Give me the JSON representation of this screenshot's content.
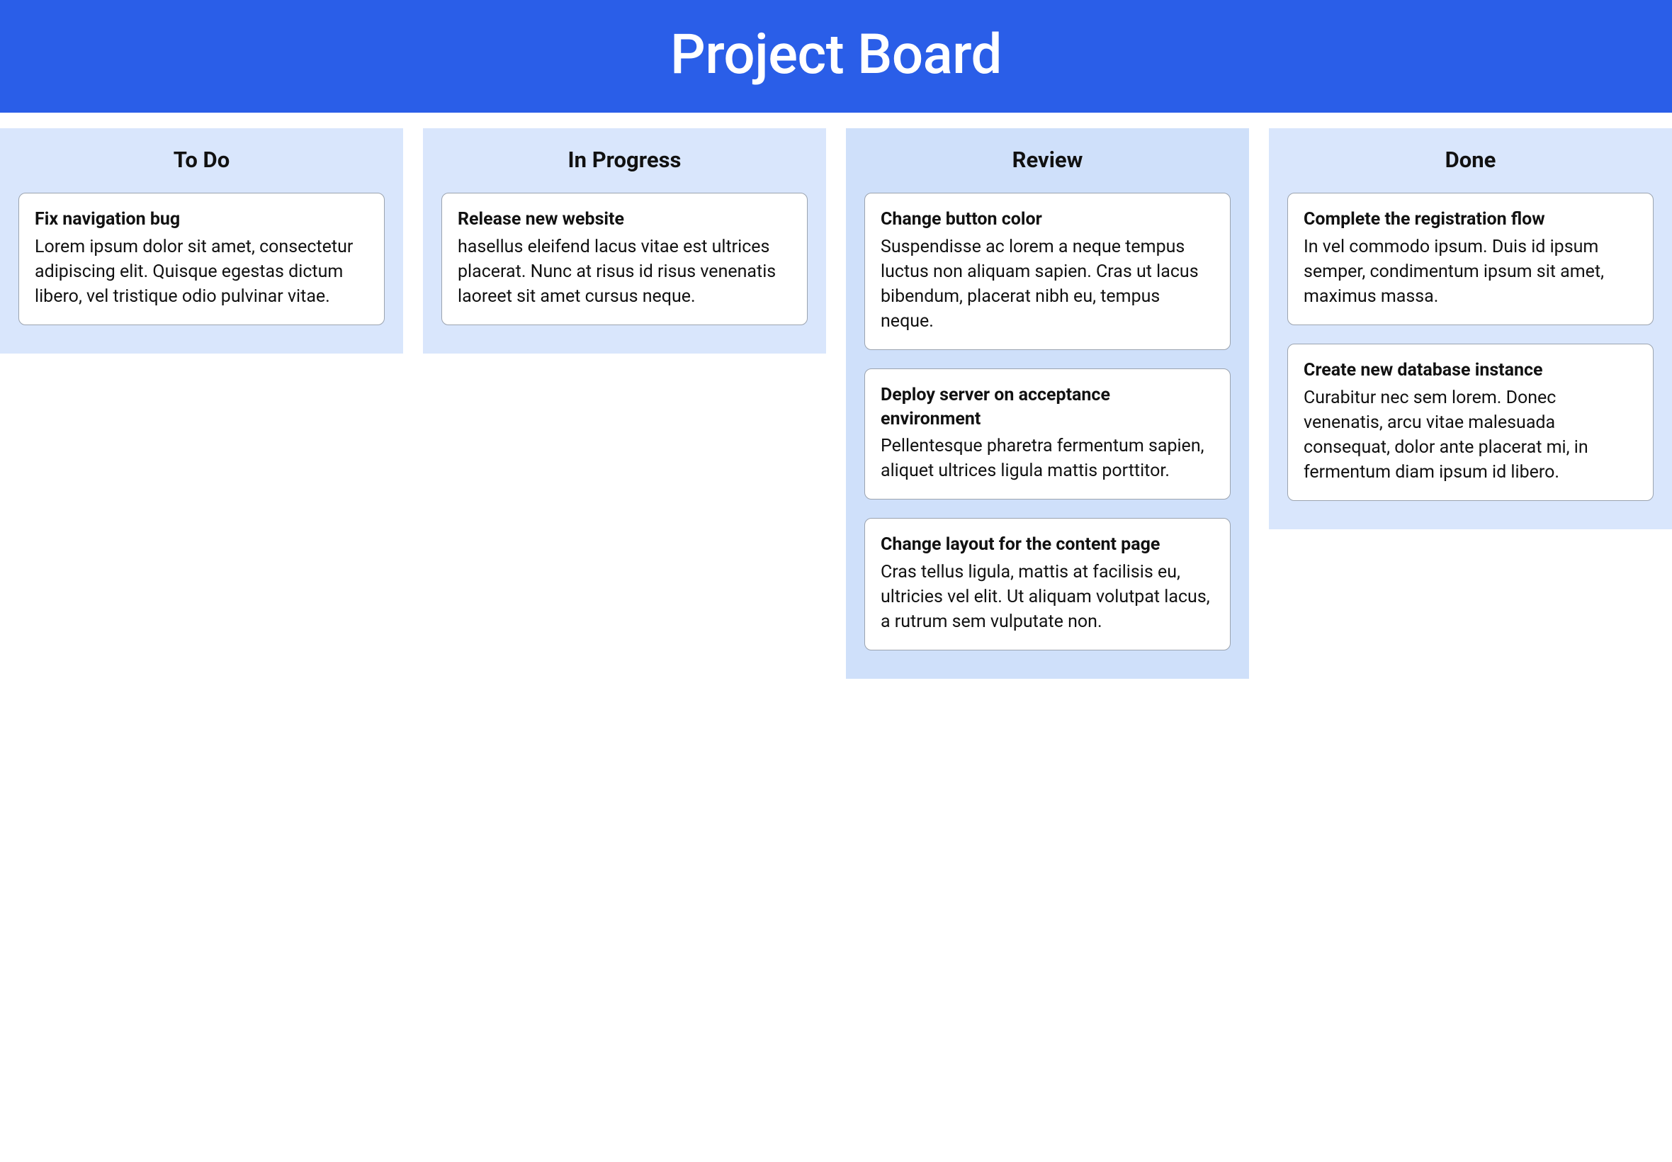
{
  "header": {
    "title": "Project Board"
  },
  "columns": [
    {
      "title": "To Do",
      "alt": false,
      "cards": [
        {
          "title": "Fix navigation bug",
          "desc": "Lorem ipsum dolor sit amet, consectetur adipiscing elit. Quisque egestas dictum libero, vel tristique odio pulvinar vitae."
        }
      ]
    },
    {
      "title": "In Progress",
      "alt": false,
      "cards": [
        {
          "title": "Release new website",
          "desc": "hasellus eleifend lacus vitae est ultrices placerat. Nunc at risus id risus venenatis laoreet sit amet cursus neque."
        }
      ]
    },
    {
      "title": "Review",
      "alt": true,
      "cards": [
        {
          "title": "Change button color",
          "desc": "Suspendisse ac lorem a neque tempus luctus non aliquam sapien. Cras ut lacus bibendum, placerat nibh eu, tempus neque."
        },
        {
          "title": "Deploy server on acceptance environment",
          "desc": "Pellentesque pharetra fermentum sapien, aliquet ultrices ligula mattis porttitor."
        },
        {
          "title": "Change layout for the content page",
          "desc": "Cras tellus ligula, mattis at facilisis eu, ultricies vel elit. Ut aliquam volutpat lacus, a rutrum sem vulputate non."
        }
      ]
    },
    {
      "title": "Done",
      "alt": false,
      "cards": [
        {
          "title": "Complete the registration flow",
          "desc": "In vel commodo ipsum. Duis id ipsum semper, condimentum ipsum sit amet, maximus massa."
        },
        {
          "title": "Create new database instance",
          "desc": "Curabitur nec sem lorem. Donec venenatis, arcu vitae malesuada consequat, dolor ante placerat mi, in fermentum diam ipsum id libero."
        }
      ]
    }
  ]
}
